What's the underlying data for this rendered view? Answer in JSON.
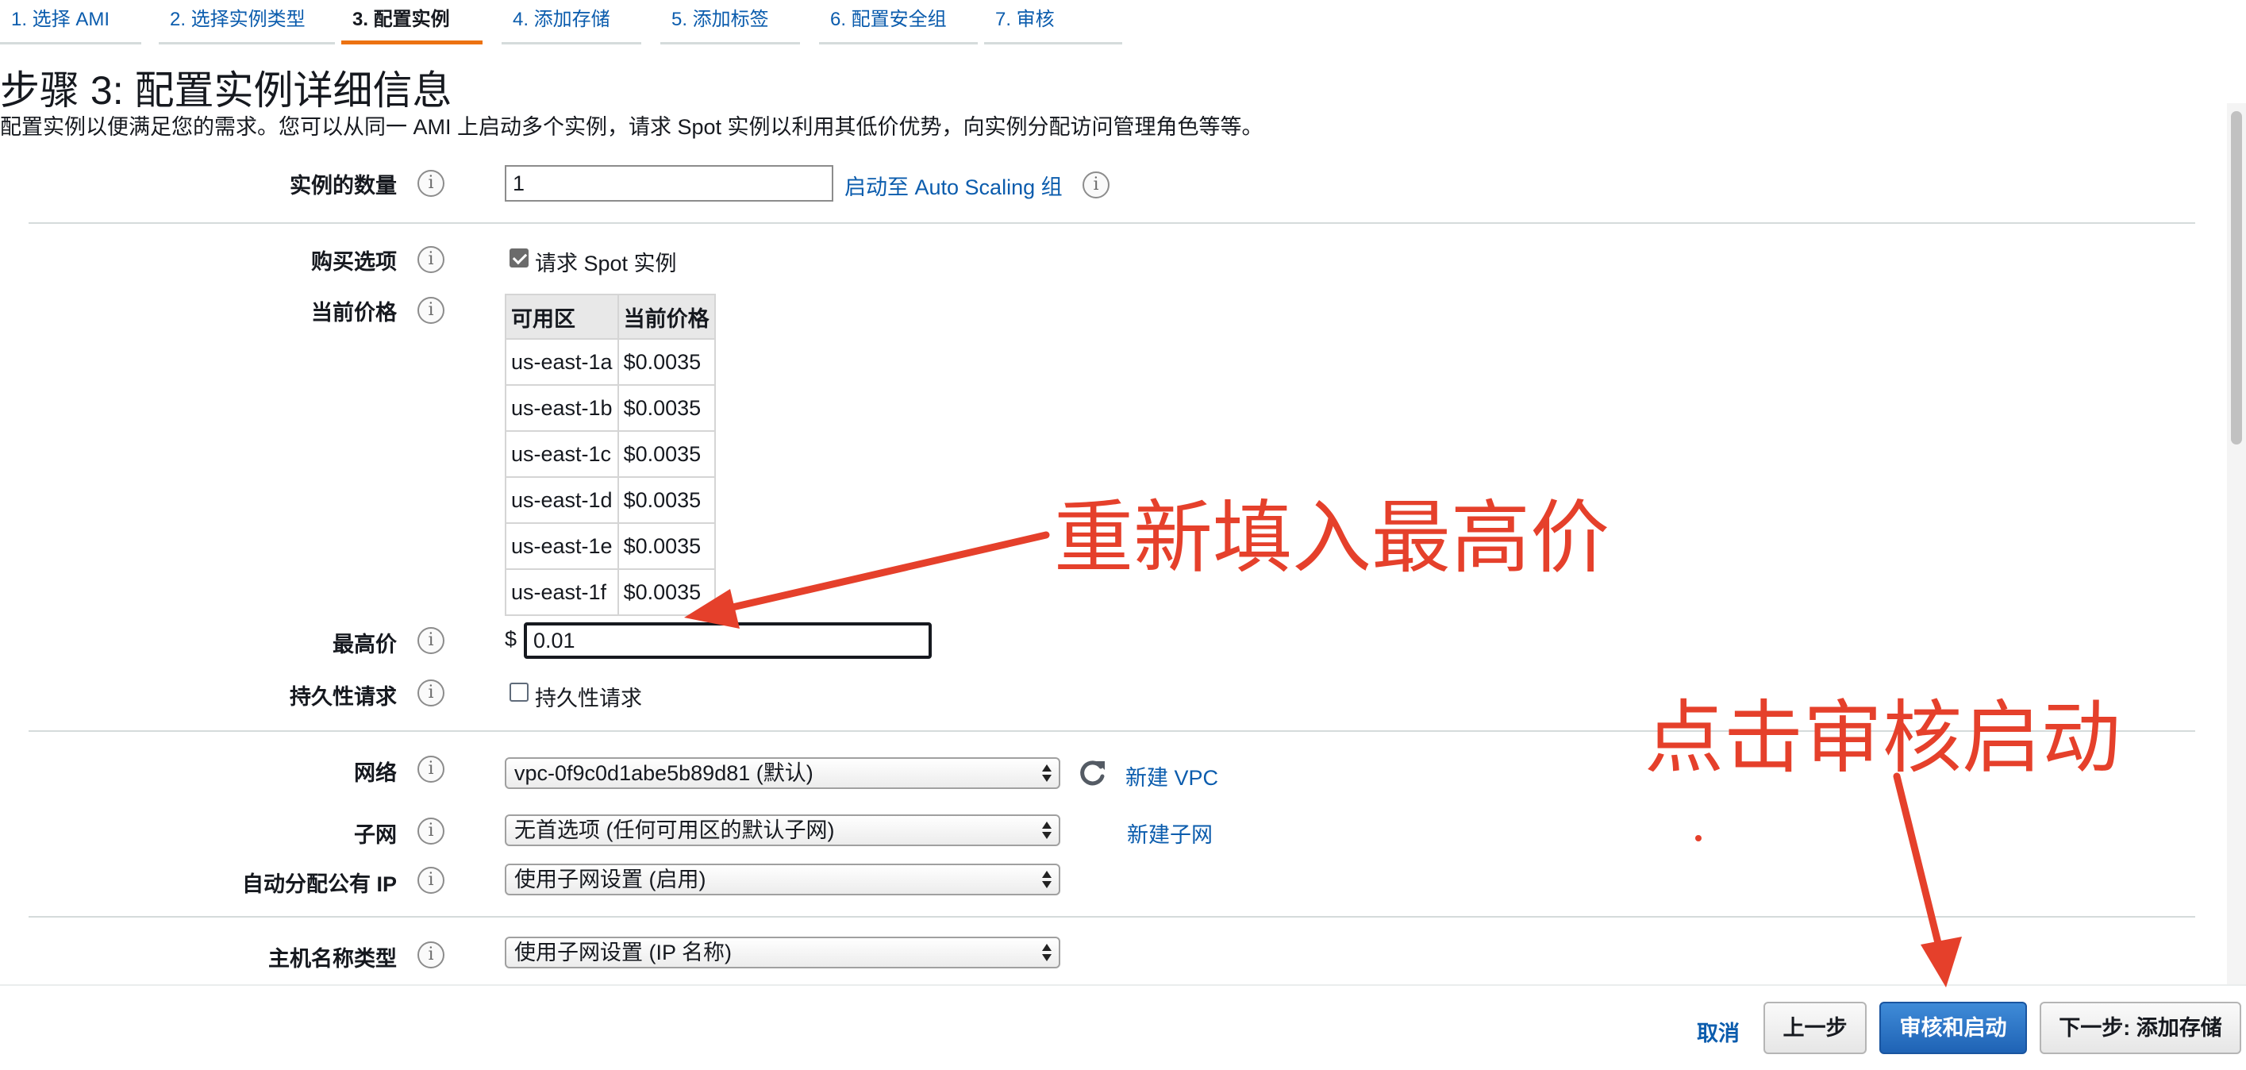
{
  "tabs": [
    {
      "label": "1. 选择 AMI"
    },
    {
      "label": "2. 选择实例类型"
    },
    {
      "label": "3. 配置实例"
    },
    {
      "label": "4. 添加存储"
    },
    {
      "label": "5. 添加标签"
    },
    {
      "label": "6. 配置安全组"
    },
    {
      "label": "7. 审核"
    }
  ],
  "active_tab": "3. 配置实例",
  "page_title": "步骤 3: 配置实例详细信息",
  "page_subtitle": "配置实例以便满足您的需求。您可以从同一 AMI 上启动多个实例，请求 Spot 实例以利用其低价优势，向实例分配访问管理角色等等。",
  "instance_count": {
    "label": "实例的数量",
    "value": "1",
    "autoscaling_link": "启动至 Auto Scaling 组"
  },
  "purchase_option": {
    "label": "购买选项",
    "checkbox_label": "请求 Spot 实例",
    "checked": true
  },
  "current_price": {
    "label": "当前价格",
    "headers": [
      "可用区",
      "当前价格"
    ],
    "rows": [
      [
        "us-east-1a",
        "$0.0035"
      ],
      [
        "us-east-1b",
        "$0.0035"
      ],
      [
        "us-east-1c",
        "$0.0035"
      ],
      [
        "us-east-1d",
        "$0.0035"
      ],
      [
        "us-east-1e",
        "$0.0035"
      ],
      [
        "us-east-1f",
        "$0.0035"
      ]
    ]
  },
  "max_price": {
    "label": "最高价",
    "currency": "$",
    "value": "0.01"
  },
  "persistent_request": {
    "label": "持久性请求",
    "checkbox_label": "持久性请求",
    "checked": false
  },
  "network": {
    "label": "网络",
    "selected": "vpc-0f9c0d1abe5b89d81 (默认)",
    "new_link": "新建 VPC"
  },
  "subnet": {
    "label": "子网",
    "selected": "无首选项 (任何可用区的默认子网)",
    "new_link": "新建子网"
  },
  "public_ip": {
    "label": "自动分配公有 IP",
    "selected": "使用子网设置 (启用)"
  },
  "hostname_type": {
    "label": "主机名称类型",
    "selected": "使用子网设置 (IP 名称)"
  },
  "footer": {
    "cancel": "取消",
    "previous": "上一步",
    "review_launch": "审核和启动",
    "next": "下一步: 添加存储"
  },
  "annotations": {
    "refill_price": "重新填入最高价",
    "click_review": "点击审核启动",
    "color": "#e5402b"
  },
  "icons": {
    "info": "info-icon",
    "refresh": "refresh-icon"
  }
}
